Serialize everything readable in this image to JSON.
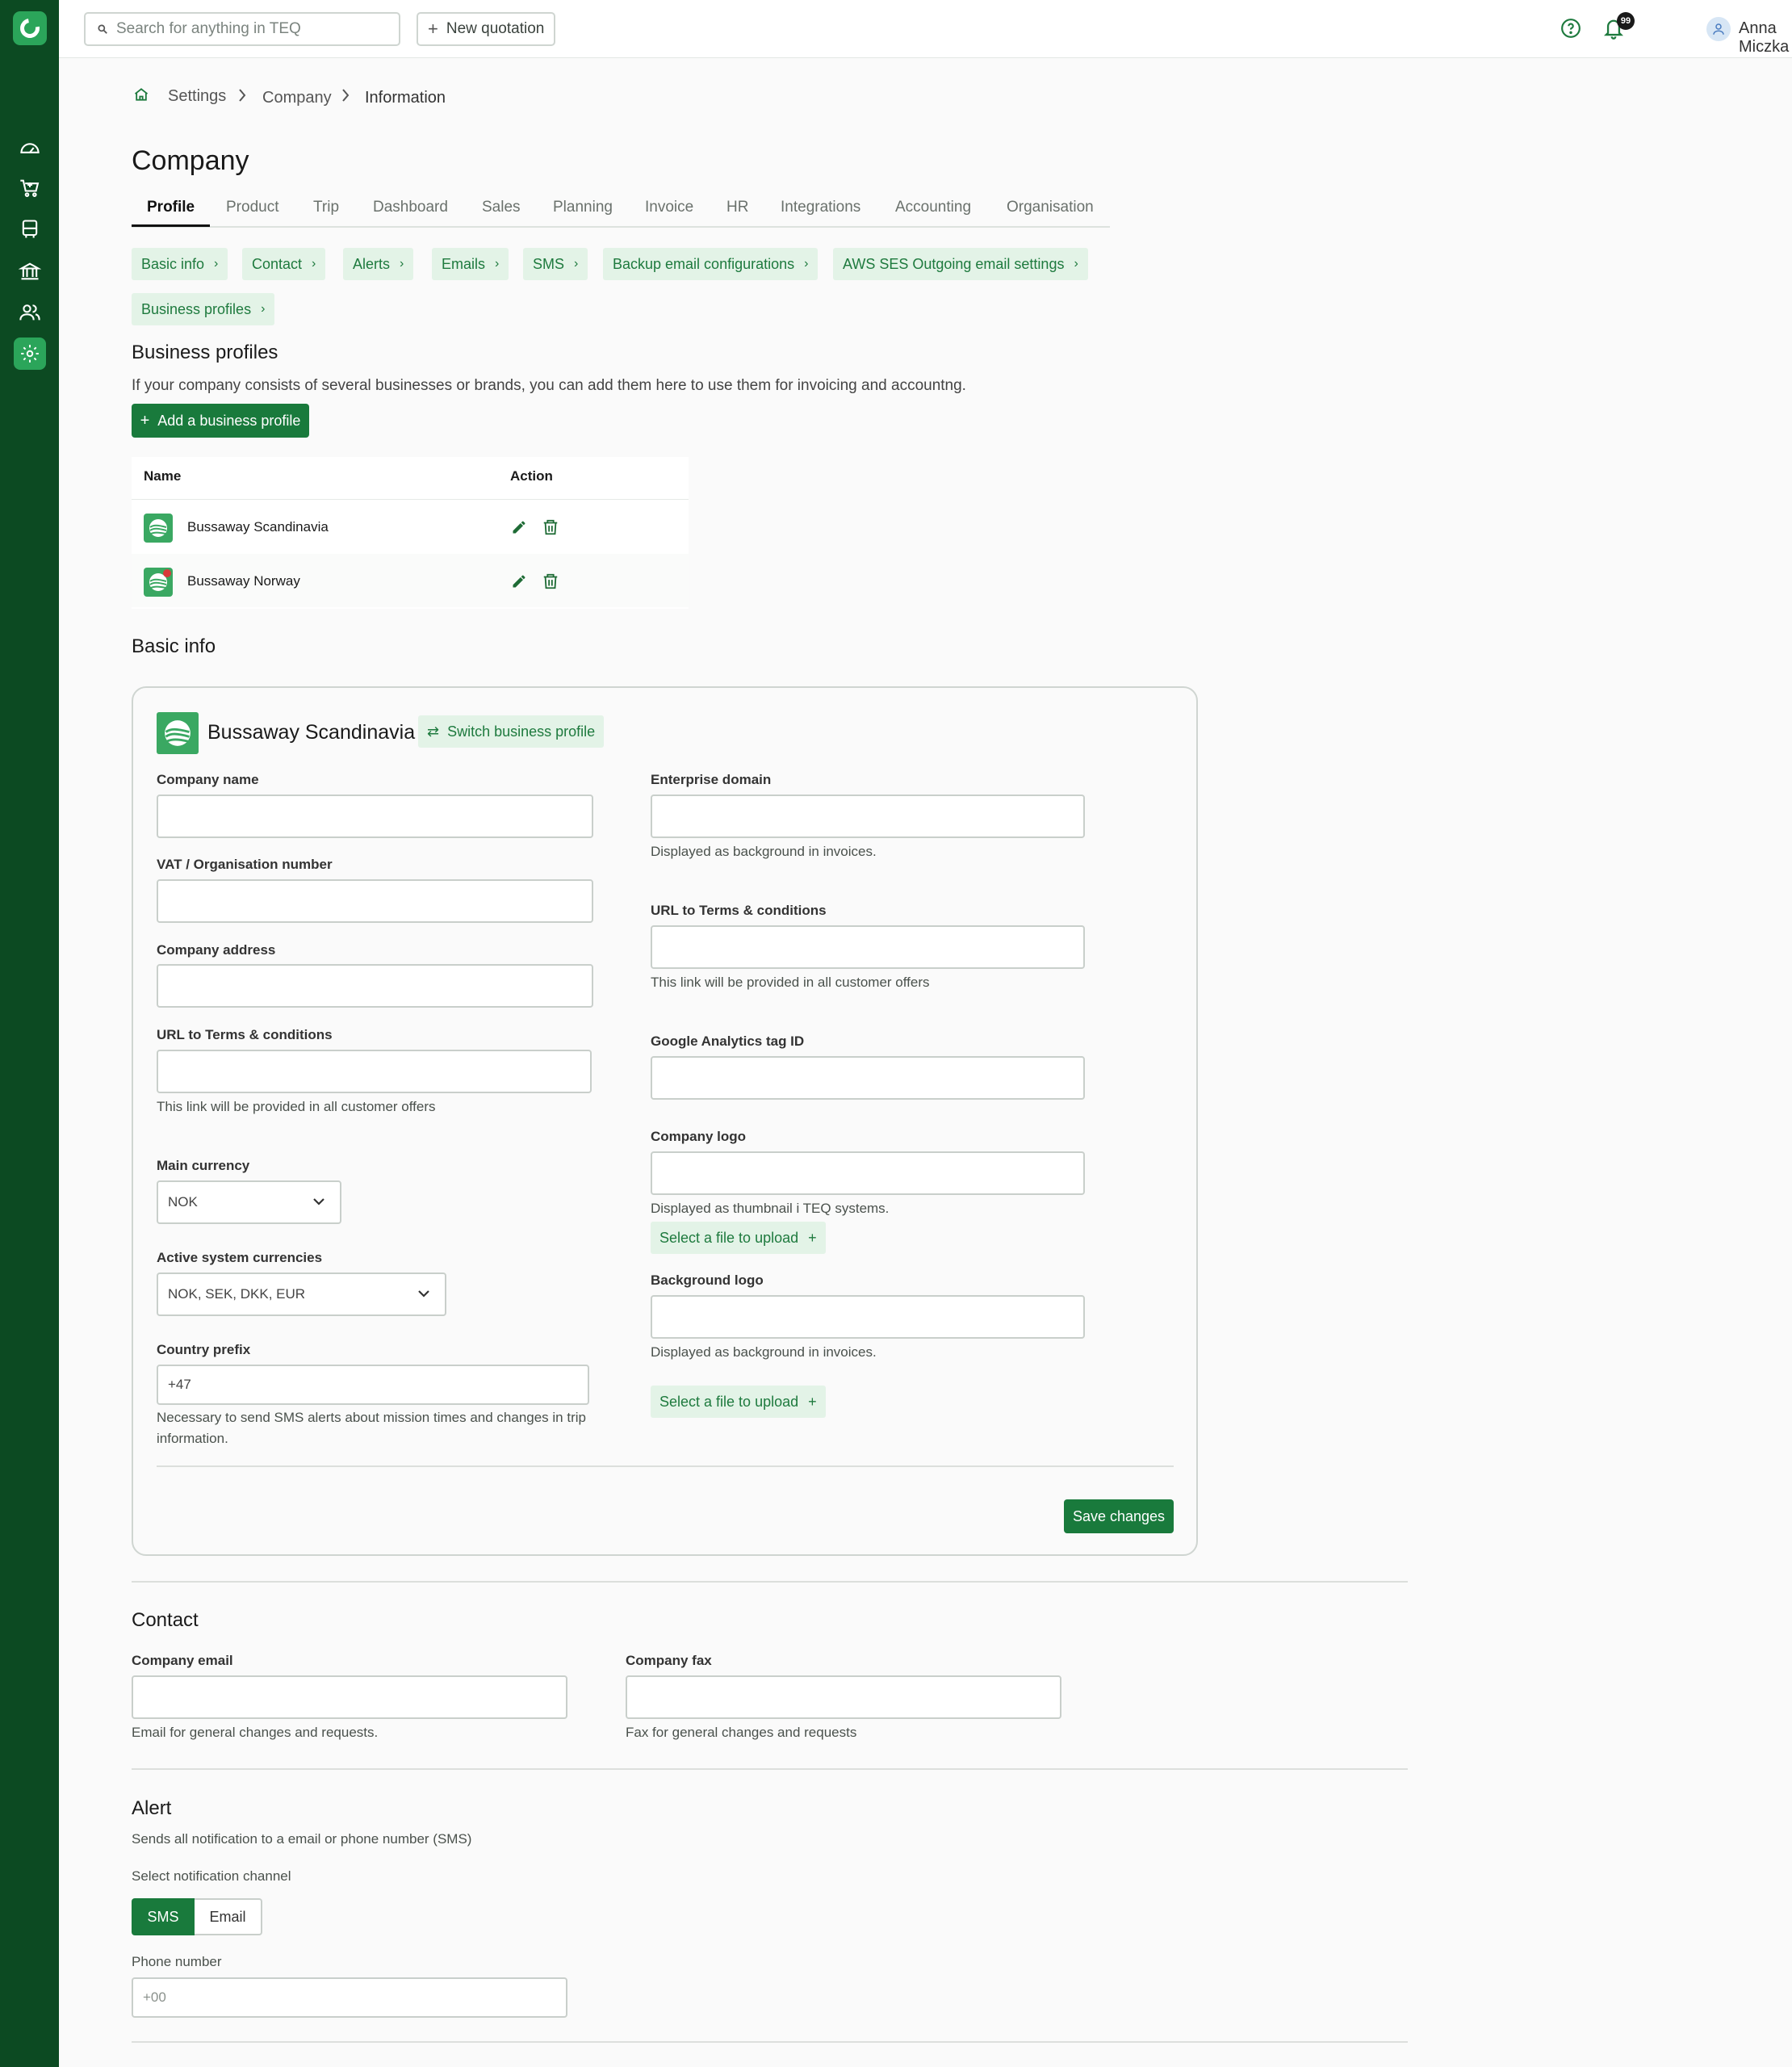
{
  "topbar": {
    "search_placeholder": "Search for anything in TEQ",
    "new_quotation": "New quotation",
    "notification_count": "99",
    "user_name": "Anna Miczka"
  },
  "sidebar": {
    "icons": [
      "dashboard-icon",
      "cart-icon",
      "bus-icon",
      "bank-icon",
      "users-icon",
      "settings-icon"
    ],
    "active": "settings-icon",
    "accent_color": "#0c4a22",
    "active_color": "#2ba55a"
  },
  "breadcrumb": {
    "items": [
      "Settings",
      "Company",
      "Information"
    ]
  },
  "page_title": "Company",
  "tabs": [
    "Profile",
    "Product",
    "Trip",
    "Dashboard",
    "Sales",
    "Planning",
    "Invoice",
    "HR",
    "Integrations",
    "Accounting",
    "Organisation"
  ],
  "active_tab": "Profile",
  "chips": [
    "Basic info",
    "Contact",
    "Alerts",
    "Emails",
    "SMS",
    "Backup email configurations",
    "AWS SES Outgoing email settings",
    "Business profiles"
  ],
  "business_profiles": {
    "title": "Business profiles",
    "description": "If your company consists of several businesses or brands, you can add them here to use them for invoicing and accountng.",
    "add_button": "Add a business profile",
    "columns": [
      "Name",
      "Action"
    ],
    "rows": [
      {
        "name": "Bussaway Scandinavia"
      },
      {
        "name": "Bussaway Norway"
      }
    ]
  },
  "basic_info": {
    "title": "Basic info",
    "profile_name": "Bussaway Scandinavia",
    "switch_label": "Switch business profile",
    "company_name_label": "Company name",
    "vat_label": "VAT / Organisation number",
    "address_label": "Company address",
    "terms_label": "URL to Terms & conditions",
    "terms_help": "This link will be provided in all customer offers",
    "main_currency_label": "Main currency",
    "main_currency_value": "NOK",
    "active_currencies_label": "Active system currencies",
    "active_currencies_value": "NOK, SEK, DKK, EUR",
    "country_prefix_label": "Country prefix",
    "country_prefix_value": "+47",
    "country_prefix_help": "Necessary to send SMS alerts about mission times and changes in trip information.",
    "enterprise_domain_label": "Enterprise domain",
    "enterprise_domain_help": "Displayed as background in invoices.",
    "terms2_label": "URL to Terms & conditions",
    "terms2_help": "This link will be provided in all customer offers",
    "ga_label": "Google Analytics tag ID",
    "company_logo_label": "Company logo",
    "company_logo_help": "Displayed as thumbnail i TEQ systems.",
    "upload_label": "Select a file to upload",
    "background_logo_label": "Background logo",
    "background_logo_help": "Displayed as background in invoices.",
    "upload2_label": "Select a file to upload",
    "save_button": "Save changes"
  },
  "contact": {
    "title": "Contact",
    "email_label": "Company email",
    "email_help": "Email for general changes and requests.",
    "fax_label": "Company fax",
    "fax_help": "Fax for general changes and requests"
  },
  "alert": {
    "title": "Alert",
    "description": "Sends all notification to a email or phone number (SMS)",
    "channel_label": "Select notification channel",
    "options": [
      "SMS",
      "Email"
    ],
    "selected": "SMS",
    "phone_label": "Phone number",
    "phone_placeholder": "+00"
  },
  "colors": {
    "brand_green": "#197a3c",
    "chip_bg": "#e3f3e7",
    "chip_text": "#1e7a3e"
  }
}
